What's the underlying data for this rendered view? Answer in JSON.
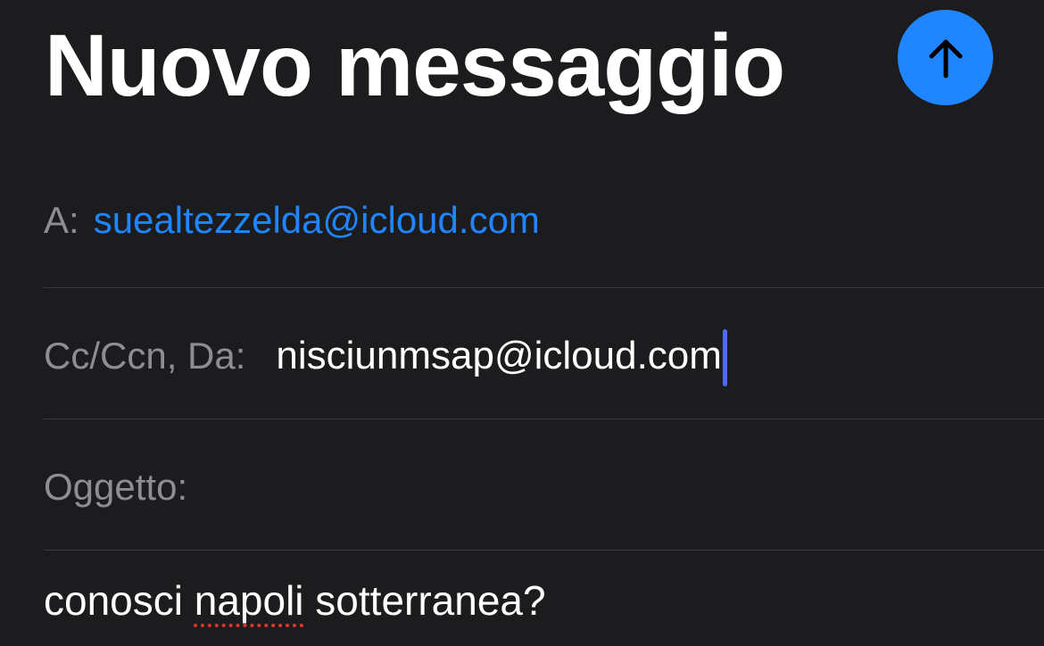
{
  "compose": {
    "title": "Nuovo messaggio",
    "send_icon": "arrow-up-icon",
    "accent_color": "#1f86ff",
    "to": {
      "label": "A:",
      "value": "suealtezzelda@icloud.com"
    },
    "cc_from": {
      "label": "Cc/Ccn, Da:",
      "value": "nisciunmsap@icloud.com"
    },
    "subject": {
      "label": "Oggetto:",
      "value": ""
    },
    "body": {
      "before": "conosci ",
      "misspelled_word": "napoli",
      "after": " sotterranea?"
    }
  }
}
